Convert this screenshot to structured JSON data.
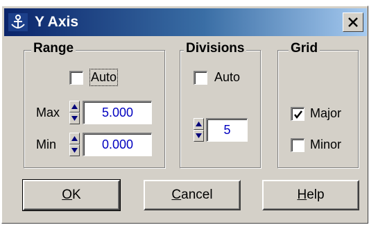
{
  "window": {
    "title": "Y Axis",
    "close_glyph": "✕"
  },
  "range": {
    "legend": "Range",
    "auto_label": "Auto",
    "auto_checked": false,
    "max_label": "Max",
    "max_value": "5.000",
    "min_label": "Min",
    "min_value": "0.000"
  },
  "divisions": {
    "legend": "Divisions",
    "auto_label": "Auto",
    "auto_checked": false,
    "value": "5"
  },
  "grid": {
    "legend": "Grid",
    "major_label": "Major",
    "major_checked": true,
    "minor_label": "Minor",
    "minor_checked": false
  },
  "buttons": {
    "ok_mnemonic": "O",
    "ok_rest": "K",
    "cancel_mnemonic": "C",
    "cancel_rest": "ancel",
    "help_mnemonic": "H",
    "help_rest": "elp"
  },
  "icons": {
    "app": "anchor-app-icon",
    "close": "close-icon",
    "spin": "spin-arrows-icon",
    "check": "check-icon"
  },
  "colors": {
    "title_gradient_start": "#0a246a",
    "title_gradient_end": "#a6caf0",
    "face": "#d4d0c8",
    "field_text": "#0000c0"
  }
}
